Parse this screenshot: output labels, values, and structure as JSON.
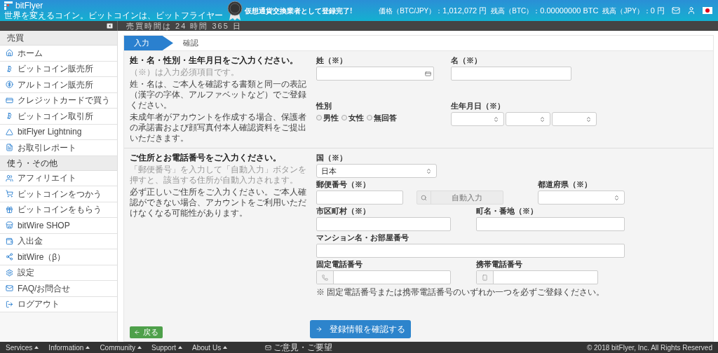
{
  "header": {
    "logo": "bitFlyer",
    "tagline": "世界を変えるコイン。ビットコインは、ビットフライヤー",
    "badge_text": "仮想通貨交換業者として登録完了!",
    "stats": [
      {
        "label": "価格（BTC/JPY）：",
        "value": "1,012,072 円"
      },
      {
        "label": "残高（BTC）：",
        "value": "0.00000000 BTC"
      },
      {
        "label": "残高（JPY）：",
        "value": "0 円"
      }
    ]
  },
  "subbar": {
    "text": "売買時間は 24 時間 365 日"
  },
  "sidebar": {
    "sections": [
      {
        "title": "売買",
        "items": [
          {
            "label": "ホーム"
          },
          {
            "label": "ビットコイン販売所"
          },
          {
            "label": "アルトコイン販売所"
          },
          {
            "label": "クレジットカードで買う"
          },
          {
            "label": "ビットコイン取引所"
          },
          {
            "label": "bitFlyer Lightning"
          },
          {
            "label": "お取引レポート"
          }
        ]
      },
      {
        "title": "使う・その他",
        "items": [
          {
            "label": "アフィリエイト"
          },
          {
            "label": "ビットコインをつかう"
          },
          {
            "label": "ビットコインをもらう"
          },
          {
            "label": "bitWire SHOP"
          },
          {
            "label": "入出金"
          },
          {
            "label": "bitWire（β）"
          },
          {
            "label": "設定"
          },
          {
            "label": "FAQ/お問合せ"
          },
          {
            "label": "ログアウト"
          }
        ]
      }
    ]
  },
  "steps": [
    {
      "label": "入力",
      "selected": true
    },
    {
      "label": "確認",
      "selected": false
    }
  ],
  "personal": {
    "title": "姓・名・性別・生年月日をご入力ください。",
    "note": "（※）は入力必須項目です。",
    "paragraphs": [
      "姓・名は、ご本人を確認する書類と同一の表記（漢字の字体、アルファベットなど）でご登録ください。",
      "未成年者がアカウントを作成する場合、保護者の承諾書および顔写真付本人確認資料をご提出いただきます。"
    ],
    "last_name": {
      "label": "姓（※）"
    },
    "first_name": {
      "label": "名（※）"
    },
    "gender": {
      "label": "性別",
      "options": [
        {
          "label": "男性",
          "selected": false
        },
        {
          "label": "女性",
          "selected": false
        },
        {
          "label": "無回答",
          "selected": false
        }
      ]
    },
    "birthdate": {
      "label": "生年月日（※）"
    }
  },
  "address": {
    "title": "ご住所とお電話番号をご入力ください。",
    "note": "「郵便番号」を入力して「自動入力」ボタンを押すと、該当する住所が自動入力されます。",
    "paragraphs": [
      "必ず正しいご住所をご入力ください。ご本人確認ができない場合、アカウントをご利用いただけなくなる可能性があります。"
    ],
    "country": {
      "label": "国（※）",
      "value": "日本"
    },
    "postal": {
      "label": "郵便番号（※）"
    },
    "auto_fill": "自動入力",
    "prefecture": {
      "label": "都道府県（※）"
    },
    "city": {
      "label": "市区町村（※）"
    },
    "street": {
      "label": "町名・番地（※）"
    },
    "building": {
      "label": "マンション名・お部屋番号"
    },
    "landline": {
      "label": "固定電話番号"
    },
    "mobile": {
      "label": "携帯電話番号"
    },
    "phone_note": "※ 固定電話番号または携帯電話番号のいずれか一つを必ずご登録ください。"
  },
  "buttons": {
    "back": "戻る",
    "confirm": "登録情報を確認する"
  },
  "footer": {
    "menus": [
      "Services",
      "Information",
      "Community",
      "Support",
      "About Us"
    ],
    "feedback": "ご意見・ご要望",
    "copyright": "© 2018 bitFlyer, Inc. All Rights Reserved"
  }
}
